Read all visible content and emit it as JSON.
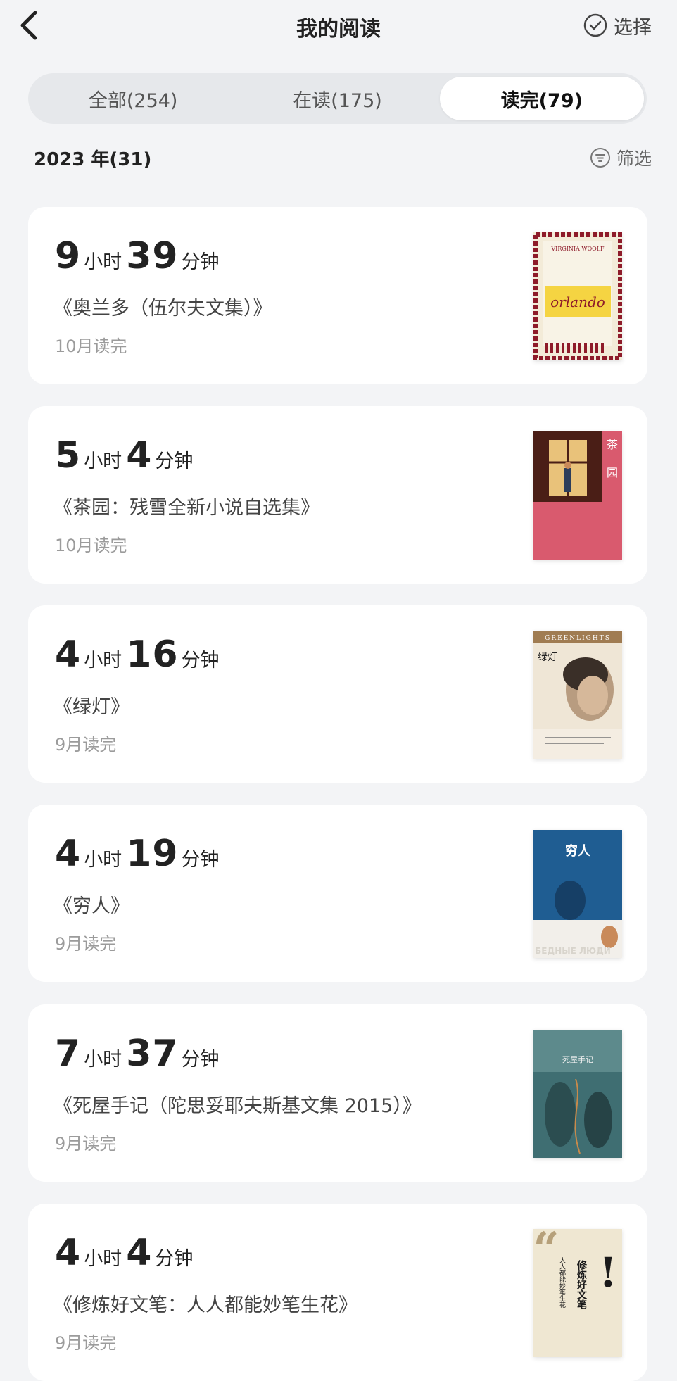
{
  "header": {
    "title": "我的阅读",
    "select_label": "选择"
  },
  "tabs": [
    {
      "label": "全部(254)",
      "active": false
    },
    {
      "label": "在读(175)",
      "active": false
    },
    {
      "label": "读完(79)",
      "active": true
    }
  ],
  "year": {
    "label": "2023 年(31)",
    "filter_label": "筛选"
  },
  "books": [
    {
      "hours": "9",
      "minutes": "39",
      "hour_unit": "小时",
      "minute_unit": "分钟",
      "title": "《奥兰多（伍尔夫文集）》",
      "finished": "10月读完",
      "cover_text": "VIRGINIA WOOLF",
      "cover_text2": "orlando"
    },
    {
      "hours": "5",
      "minutes": "4",
      "hour_unit": "小时",
      "minute_unit": "分钟",
      "title": "《茶园：残雪全新小说自选集》",
      "finished": "10月读完",
      "cover_text": "茶",
      "cover_text2": "园"
    },
    {
      "hours": "4",
      "minutes": "16",
      "hour_unit": "小时",
      "minute_unit": "分钟",
      "title": "《绿灯》",
      "finished": "9月读完",
      "cover_text": "GREENLIGHTS",
      "cover_text2": "绿灯"
    },
    {
      "hours": "4",
      "minutes": "19",
      "hour_unit": "小时",
      "minute_unit": "分钟",
      "title": "《穷人》",
      "finished": "9月读完",
      "cover_text": "穷人",
      "cover_text2": "БЕДНЫЕ ЛЮДИ"
    },
    {
      "hours": "7",
      "minutes": "37",
      "hour_unit": "小时",
      "minute_unit": "分钟",
      "title": "《死屋手记（陀思妥耶夫斯基文集 2015）》",
      "finished": "9月读完",
      "cover_text": "死屋手记",
      "cover_text2": ""
    },
    {
      "hours": "4",
      "minutes": "4",
      "hour_unit": "小时",
      "minute_unit": "分钟",
      "title": "《修炼好文笔：人人都能妙笔生花》",
      "finished": "9月读完",
      "cover_text": "修炼好文笔",
      "cover_text2": "人人都能妙笔生花"
    }
  ]
}
